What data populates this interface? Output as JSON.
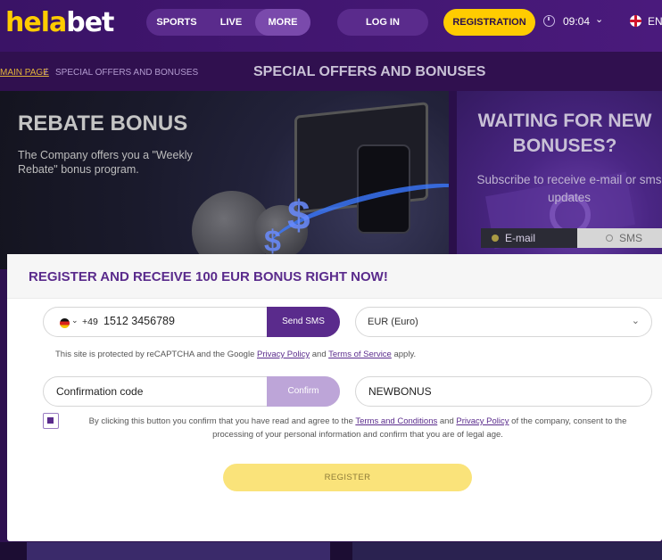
{
  "header": {
    "logo_left": "hela",
    "logo_right": "bet",
    "nav": [
      {
        "label": "SPORTS"
      },
      {
        "label": "LIVE"
      },
      {
        "label": "MORE"
      }
    ],
    "login_label": "LOG IN",
    "registration_label": "REGISTRATION",
    "time": "09:04",
    "language": "EN"
  },
  "breadcrumb": {
    "main": "MAIN PAGE",
    "separator": "/",
    "current": "SPECIAL OFFERS AND BONUSES"
  },
  "page_title": "SPECIAL OFFERS AND BONUSES",
  "rebate_card": {
    "title": "REBATE BONUS",
    "text": "The Company offers you a \"Weekly Rebate\" bonus program."
  },
  "wait_card": {
    "title": "WAITING FOR NEW BONUSES?",
    "subtitle": "Subscribe to receive e-mail or sms updates",
    "toggle": [
      "E-mail",
      "SMS"
    ]
  },
  "modal": {
    "title": "REGISTER AND RECEIVE 100 EUR BONUS RIGHT NOW!",
    "phone": {
      "dial_code": "+49",
      "number": "1512 3456789",
      "send_label": "Send SMS"
    },
    "currency": "EUR (Euro)",
    "recaptcha": {
      "prefix": "This site is protected by reCAPTCHA and the Google ",
      "privacy": "Privacy Policy",
      "and": " and ",
      "terms": "Terms of Service",
      "suffix": " apply."
    },
    "confirmation": {
      "label": "Confirmation code",
      "button": "Confirm"
    },
    "promo_code": "NEWBONUS",
    "consent": {
      "prefix": "By clicking this button you confirm that you have read and agree to the ",
      "terms": "Terms and Conditions",
      "and": " and ",
      "privacy": "Privacy Policy",
      "suffix": " of the company, consent to the processing of your personal information and confirm that you are of legal age."
    },
    "register_label": "REGISTER"
  },
  "colors": {
    "brand_purple": "#5a2b8c",
    "brand_yellow": "#ffcc00",
    "header_bg": "#3a1366"
  }
}
